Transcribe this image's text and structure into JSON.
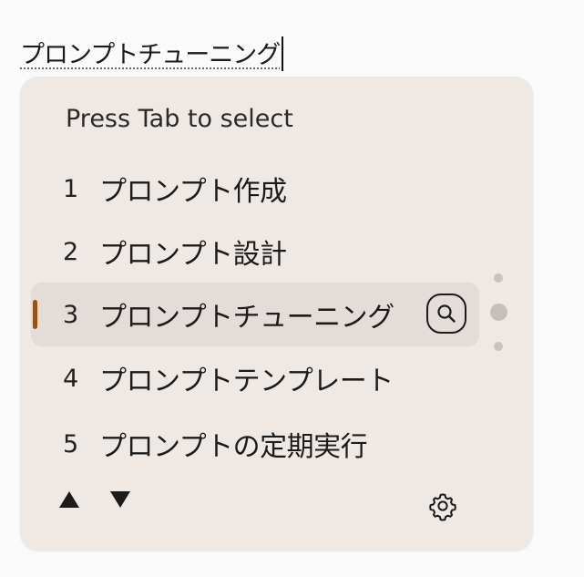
{
  "composition": {
    "text": "プロンプトチューニング"
  },
  "candidate_window": {
    "hint": "Press Tab to select",
    "candidates": [
      {
        "number": "1",
        "text": "プロンプト作成"
      },
      {
        "number": "2",
        "text": "プロンプト設計"
      },
      {
        "number": "3",
        "text": "プロンプトチューニング"
      },
      {
        "number": "4",
        "text": "プロンプトテンプレート"
      },
      {
        "number": "5",
        "text": "プロンプトの定期実行"
      }
    ],
    "selected_index": 3,
    "icons": {
      "search": "search-icon",
      "previous": "triangle-up-icon",
      "next": "triangle-down-icon",
      "settings": "gear-icon"
    },
    "accent_color": "#9a5310",
    "background_color": "#efe9e6",
    "selected_background_color": "#e3dcd8"
  }
}
